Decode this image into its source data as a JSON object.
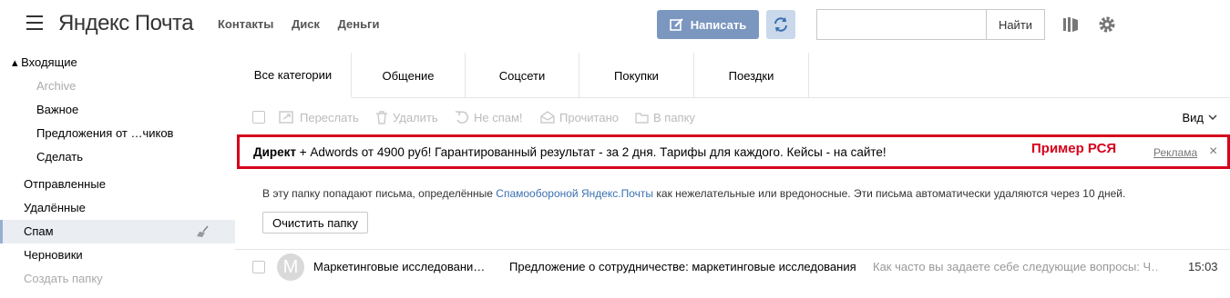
{
  "header": {
    "logo_yandex": "Яндекс",
    "logo_mail": "Почта",
    "links": [
      "Контакты",
      "Диск",
      "Деньги"
    ],
    "compose_label": "Написать",
    "search_placeholder": "",
    "search_button": "Найти"
  },
  "sidebar": {
    "folders": [
      {
        "label": "▴ Входящие"
      },
      {
        "label": "Archive"
      },
      {
        "label": "Важное"
      },
      {
        "label": "Предложения от …чиков"
      },
      {
        "label": "Сделать"
      },
      {
        "label": "Отправленные"
      },
      {
        "label": "Удалённые"
      },
      {
        "label": "Спам"
      },
      {
        "label": "Черновики"
      },
      {
        "label": "Создать папку"
      }
    ]
  },
  "tabs": [
    {
      "label": "Все категории"
    },
    {
      "label": "Общение"
    },
    {
      "label": "Соцсети"
    },
    {
      "label": "Покупки"
    },
    {
      "label": "Поездки"
    }
  ],
  "toolbar": {
    "forward": "Переслать",
    "delete": "Удалить",
    "not_spam": "Не спам!",
    "read": "Прочитано",
    "to_folder": "В папку",
    "view": "Вид"
  },
  "ad": {
    "brand": "Директ",
    "text": " + Adwords от 4900 руб! Гарантированный результат - за 2 дня. Тарифы для каждого. Кейсы - на сайте!",
    "example_label": "Пример РСЯ",
    "ad_label": "Реклама",
    "close": "×"
  },
  "spam_note": {
    "before": "В эту папку попадают письма, определённые ",
    "link": "Спамообороной Яндекс.Почты",
    "after": " как нежелательные или вредоносные. Эти письма автоматически удаляются через 10 дней.",
    "clear_button": "Очистить папку"
  },
  "messages": [
    {
      "avatar_letter": "M",
      "from": "Маркетинговые исследовани…",
      "subject": "Предложение о сотрудничестве: маркетинговые исследования",
      "first_line": "Как часто вы задаете себе следующие вопросы: Ч…",
      "date": "15:03"
    }
  ],
  "colors": {
    "compose_bg": "#7b97c0",
    "refresh_bg": "#c9d8ea",
    "ad_border": "#d6001c",
    "link": "#3a70b0"
  }
}
